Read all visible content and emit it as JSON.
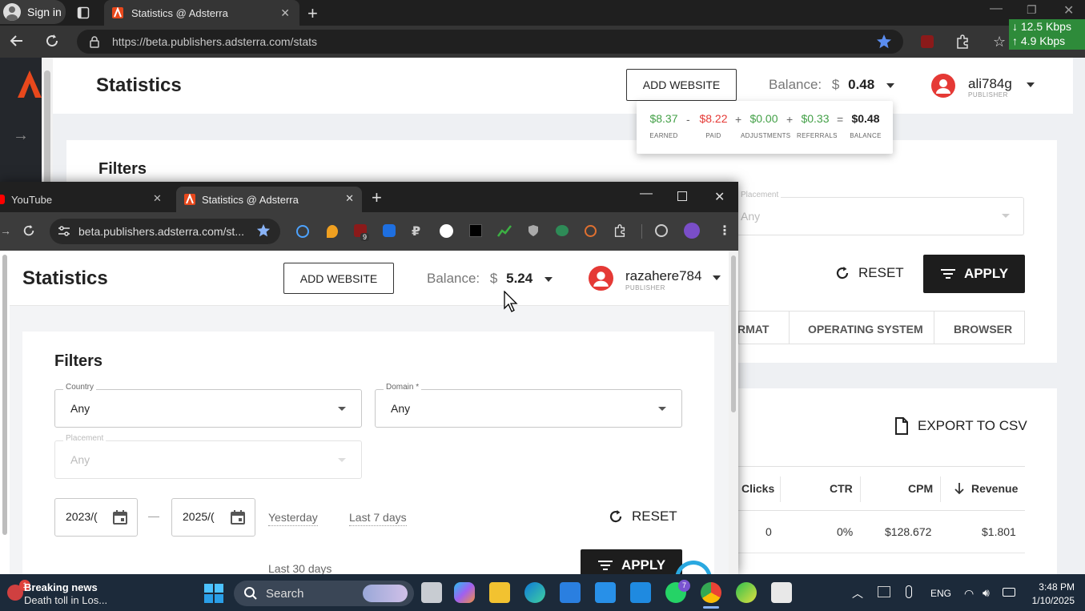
{
  "back_window": {
    "signin_label": "Sign in",
    "tab_title": "Statistics @ Adsterra",
    "url": "https://beta.publishers.adsterra.com/stats",
    "net_down": "↓ 12.5 Kbps",
    "net_up": "↑ 4.9 Kbps",
    "page_title": "Statistics",
    "add_website": "ADD WEBSITE",
    "balance_label": "Balance:",
    "balance_currency": "$",
    "balance_value": "0.48",
    "username": "ali784g",
    "user_role": "PUBLISHER",
    "popover": {
      "earned": "$8.37",
      "earned_label": "EARNED",
      "paid": "$8.22",
      "paid_label": "PAID",
      "adjustments": "$0.00",
      "adjustments_label": "ADJUSTMENTS",
      "referrals": "$0.33",
      "referrals_label": "REFERRALS",
      "balance": "$0.48",
      "balance_label": "BALANCE",
      "op_minus": "-",
      "op_plus": "+",
      "op_eq": "="
    },
    "filters_title": "Filters",
    "placement_label": "Placement",
    "placement_value": "Any",
    "reset": "RESET",
    "apply": "APPLY",
    "tabs": [
      "RMAT",
      "OPERATING SYSTEM",
      "BROWSER"
    ],
    "export": "EXPORT TO CSV",
    "table": {
      "headers": [
        "Clicks",
        "CTR",
        "CPM",
        "Revenue"
      ],
      "row1": [
        "0",
        "0%",
        "$128.672",
        "$1.801"
      ]
    }
  },
  "front_window": {
    "tab1_title": "YouTube",
    "tab2_title": "Statistics @ Adsterra",
    "url": "beta.publishers.adsterra.com/st...",
    "ext_badge": "9",
    "page_title": "Statistics",
    "add_website": "ADD WEBSITE",
    "balance_label": "Balance:",
    "balance_currency": "$",
    "balance_value": "5.24",
    "username": "razahere784",
    "user_role": "PUBLISHER",
    "filters_title": "Filters",
    "country_label": "Country",
    "country_value": "Any",
    "domain_label": "Domain *",
    "domain_value": "Any",
    "placement_label": "Placement",
    "placement_value": "Any",
    "date_from": "2023/(",
    "date_to": "2025/(",
    "date_sep": "—",
    "quick": [
      "Yesterday",
      "Last 7 days",
      "Last 30 days"
    ],
    "reset": "RESET",
    "apply": "APPLY"
  },
  "taskbar": {
    "news_badge": "1",
    "news_title": "Breaking news",
    "news_sub": "Death toll in Los...",
    "search_placeholder": "Search",
    "whatsapp_badge": "7",
    "lang": "ENG",
    "time": "3:48 PM",
    "date": "1/10/2025"
  },
  "colors": {
    "earned": "#43a047",
    "paid": "#e53935",
    "dark_button": "#1d1d1d",
    "taskbar": "#1c2a3a",
    "net_badge": "#2e8b3a"
  }
}
